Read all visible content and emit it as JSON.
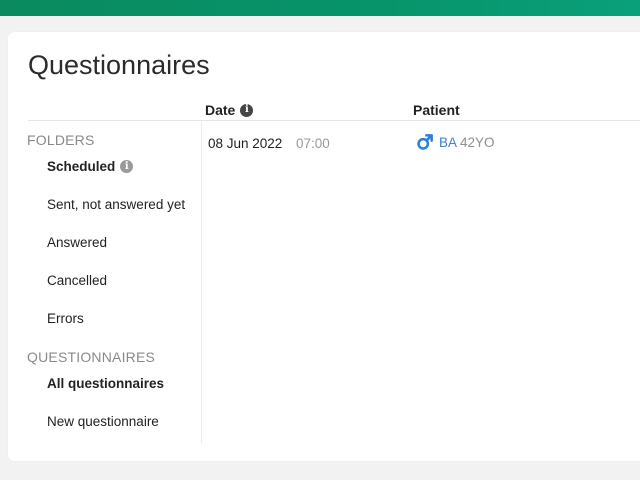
{
  "page": {
    "title": "Questionnaires"
  },
  "table": {
    "columns": {
      "date": "Date",
      "patient": "Patient"
    },
    "rows": [
      {
        "date": "08 Jun 2022",
        "time": "07:00",
        "patient_initials": "BA",
        "patient_age": "42YO",
        "gender_icon": "male-icon"
      }
    ]
  },
  "sidebar": {
    "folders_label": "FOLDERS",
    "folders": [
      {
        "label": "Scheduled",
        "active": true
      },
      {
        "label": "Sent, not answered yet"
      },
      {
        "label": "Answered"
      },
      {
        "label": "Cancelled"
      },
      {
        "label": "Errors"
      }
    ],
    "questionnaires_label": "QUESTIONNAIRES",
    "questionnaires": [
      {
        "label": "All questionnaires",
        "active": true
      },
      {
        "label": "New questionnaire"
      }
    ]
  },
  "colors": {
    "brand": "#07946b",
    "link": "#3d7fd0",
    "muted": "#8a8a8a"
  }
}
